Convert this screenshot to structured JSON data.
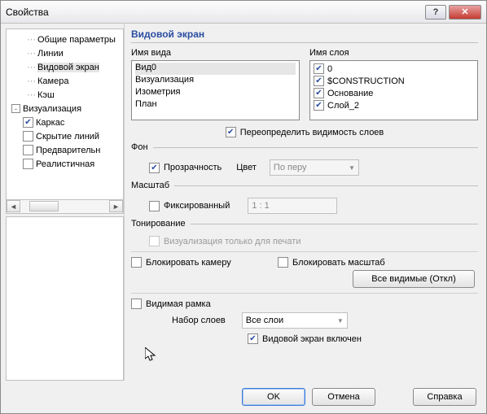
{
  "title": "Свойства",
  "sidebar": {
    "items": [
      {
        "label": "Общие параметры",
        "indent": 1,
        "dots": true
      },
      {
        "label": "Линии",
        "indent": 1,
        "dots": true
      },
      {
        "label": "Видовой экран",
        "indent": 1,
        "dots": true,
        "selected": true
      },
      {
        "label": "Камера",
        "indent": 1,
        "dots": true
      },
      {
        "label": "Кэш",
        "indent": 1,
        "dots": true
      },
      {
        "label": "Визуализация",
        "indent": 0,
        "toggle": "-"
      },
      {
        "label": "Каркас",
        "indent": 1,
        "checkbox": true,
        "checked": true
      },
      {
        "label": "Скрытие линий",
        "indent": 1,
        "checkbox": true,
        "checked": false
      },
      {
        "label": "Предварительн",
        "indent": 1,
        "checkbox": true,
        "checked": false
      },
      {
        "label": "Реалистичная",
        "indent": 1,
        "checkbox": true,
        "checked": false
      }
    ]
  },
  "panel": {
    "title": "Видовой экран",
    "viewName": {
      "label": "Имя вида",
      "items": [
        "Вид0",
        "Визуализация",
        "Изометрия",
        "План"
      ],
      "selected": "Вид0"
    },
    "layerName": {
      "label": "Имя слоя",
      "items": [
        {
          "label": "0",
          "checked": true
        },
        {
          "label": "$CONSTRUCTION",
          "checked": true
        },
        {
          "label": "Основание",
          "checked": true
        },
        {
          "label": "Слой_2",
          "checked": true
        }
      ]
    },
    "overrideLayers": {
      "label": "Переопределить видимость слоев",
      "checked": true
    },
    "background": {
      "title": "Фон",
      "transparency": {
        "label": "Прозрачность",
        "checked": true
      },
      "colorLabel": "Цвет",
      "colorValue": "По перу"
    },
    "scale": {
      "title": "Масштаб",
      "fixed": {
        "label": "Фиксированный",
        "checked": false
      },
      "value": "1 : 1"
    },
    "toning": {
      "title": "Тонирование",
      "printOnly": "Визуализация только для печати"
    },
    "lockCamera": {
      "label": "Блокировать камеру",
      "checked": false
    },
    "lockScale": {
      "label": "Блокировать масштаб",
      "checked": false
    },
    "allVisibleBtn": "Все видимые (Откл)",
    "visibleFrame": {
      "label": "Видимая рамка",
      "checked": false
    },
    "layerSet": {
      "label": "Набор слоев",
      "value": "Все слои"
    },
    "viewportOn": {
      "label": "Видовой экран включен",
      "checked": true
    }
  },
  "buttons": {
    "ok": "OK",
    "cancel": "Отмена",
    "help": "Справка"
  }
}
